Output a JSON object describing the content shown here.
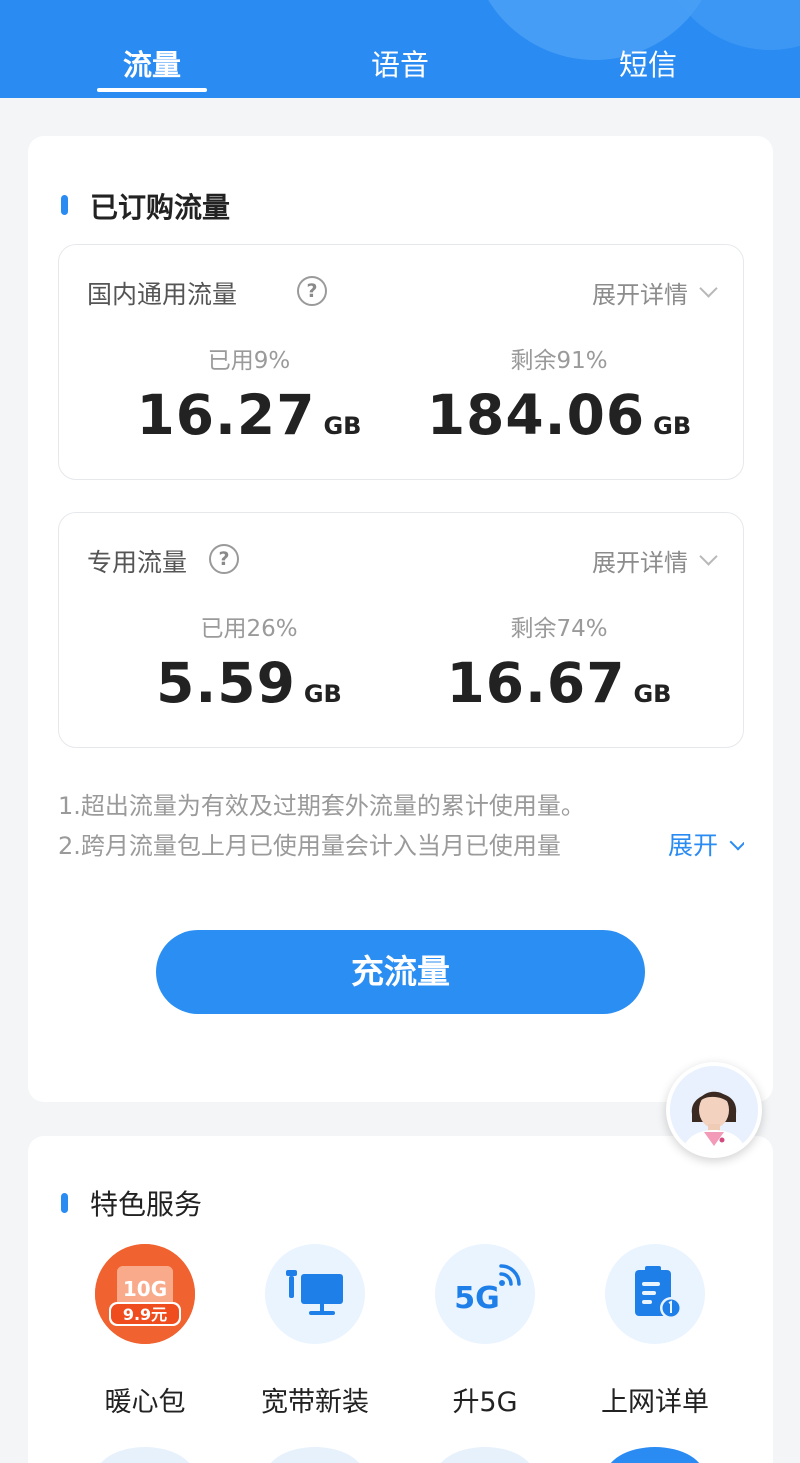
{
  "tabs": [
    {
      "label": "流量",
      "active": true
    },
    {
      "label": "语音",
      "active": false
    },
    {
      "label": "短信",
      "active": false
    }
  ],
  "subscribed": {
    "title": "已订购流量",
    "domestic": {
      "title": "国内通用流量",
      "detail_label": "展开详情",
      "used_pct_label": "已用9%",
      "used_value": "16.27",
      "used_unit": "GB",
      "remain_pct_label": "剩余91%",
      "remain_value": "184.06",
      "remain_unit": "GB",
      "used_fraction": 0.09
    },
    "dedicated": {
      "title": "专用流量",
      "detail_label": "展开详情",
      "used_pct_label": "已用26%",
      "used_value": "5.59",
      "used_unit": "GB",
      "remain_pct_label": "剩余74%",
      "remain_value": "16.67",
      "remain_unit": "GB",
      "used_fraction": 0.26
    },
    "notes": [
      "1.超出流量为有效及过期套外流量的累计使用量。",
      "2.跨月流量包上月已使用量会计入当月已使用量"
    ],
    "expand_label": "展开",
    "recharge_button": "充流量"
  },
  "services": {
    "title": "特色服务",
    "items": [
      {
        "label": "暖心包",
        "badge_top": "10G",
        "badge_price": "9.9元",
        "icon": "gift-box-icon"
      },
      {
        "label": "宽带新装",
        "icon": "broadband-monitor-icon"
      },
      {
        "label": "升5G",
        "icon_text": "5G",
        "icon": "5g-signal-icon"
      },
      {
        "label": "上网详单",
        "icon": "clipboard-bill-icon"
      }
    ]
  },
  "colors": {
    "primary": "#2a8bf2",
    "text": "#222222",
    "muted": "#9a9a9a",
    "background": "#f3f5f7"
  }
}
